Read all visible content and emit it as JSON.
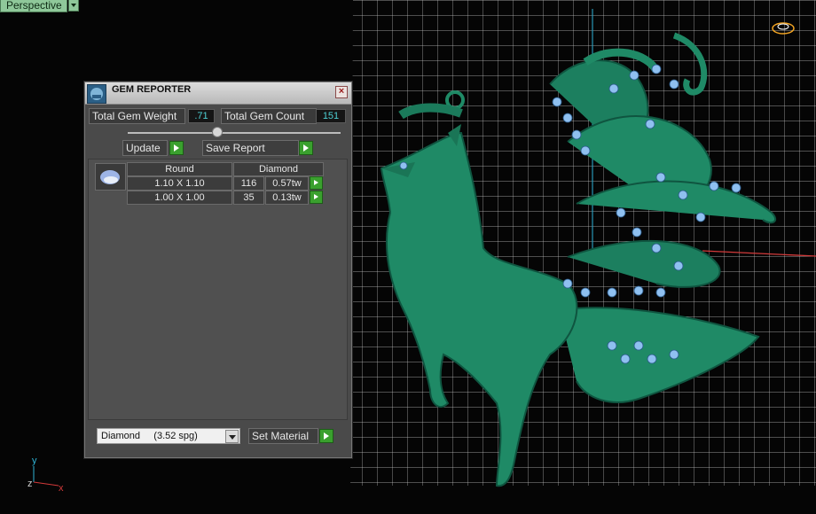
{
  "viewport": {
    "view_label": "Perspective",
    "axis_labels": {
      "y": "y",
      "z": "z",
      "x": "x"
    }
  },
  "gem_reporter": {
    "title": "GEM REPORTER",
    "close_glyph": "×",
    "total_weight_label": "Total Gem Weight",
    "total_weight_value": ".71",
    "total_count_label": "Total Gem Count",
    "total_count_value": "151",
    "update_label": "Update",
    "save_report_label": "Save Report",
    "table": {
      "shape": "Round",
      "material": "Diamond",
      "rows": [
        {
          "size": "1.10 X 1.10",
          "count": "116",
          "weight": "0.57tw"
        },
        {
          "size": "1.00 X 1.00",
          "count": "35",
          "weight": "0.13tw"
        }
      ]
    },
    "material_select_value": "Diamond     (3.52 spg)",
    "set_material_label": "Set Material"
  },
  "colors": {
    "model": "#1f8a66",
    "gem": "#8fc0f0",
    "grid": "#ffffff",
    "button_green": "#3aa02e",
    "value_cyan": "#4dd0d4"
  }
}
